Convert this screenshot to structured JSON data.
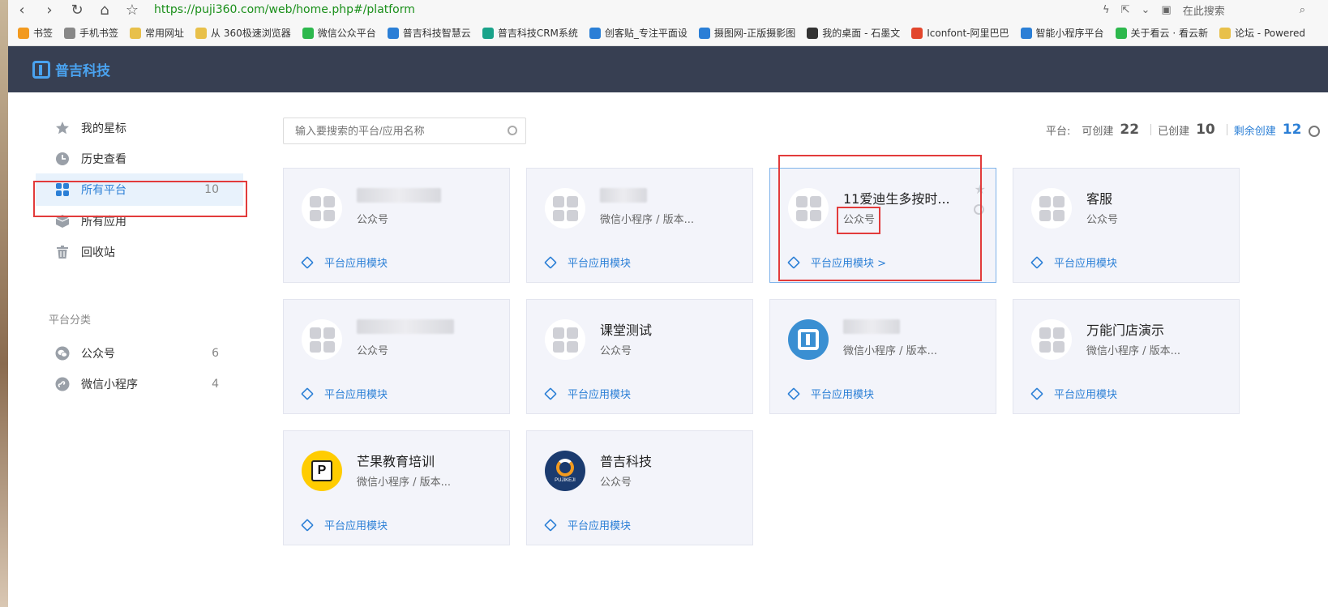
{
  "browser": {
    "url": "https://puji360.com/web/home.php#/platform",
    "search_placeholder": "在此搜索",
    "bookmarks": [
      {
        "label": "书签",
        "color": "#f29a1f"
      },
      {
        "label": "手机书签",
        "color": "#888888"
      },
      {
        "label": "常用网址",
        "color": "#e8c04a"
      },
      {
        "label": "从 360极速浏览器",
        "color": "#e8c04a"
      },
      {
        "label": "微信公众平台",
        "color": "#2db84d"
      },
      {
        "label": "普吉科技智慧云",
        "color": "#2b7fd6"
      },
      {
        "label": "普吉科技CRM系统",
        "color": "#1aa38a"
      },
      {
        "label": "创客贴_专注平面设",
        "color": "#2b7fd6"
      },
      {
        "label": "摄图网-正版摄影图",
        "color": "#2b7fd6"
      },
      {
        "label": "我的桌面 - 石墨文",
        "color": "#333333"
      },
      {
        "label": "Iconfont-阿里巴巴",
        "color": "#e2462c"
      },
      {
        "label": "智能小程序平台",
        "color": "#2b7fd6"
      },
      {
        "label": "关于看云 · 看云新",
        "color": "#2db84d"
      },
      {
        "label": "论坛 - Powered",
        "color": "#e8c04a"
      }
    ]
  },
  "header": {
    "logo_text": "普吉科技"
  },
  "sidebar": {
    "items": [
      {
        "label": "我的星标",
        "icon": "star-icon",
        "count": ""
      },
      {
        "label": "历史查看",
        "icon": "clock-icon",
        "count": ""
      },
      {
        "label": "所有平台",
        "icon": "grid-icon",
        "count": "10"
      },
      {
        "label": "所有应用",
        "icon": "cube-icon",
        "count": ""
      },
      {
        "label": "回收站",
        "icon": "trash-icon",
        "count": ""
      }
    ],
    "section_title": "平台分类",
    "categories": [
      {
        "label": "公众号",
        "icon": "wechat-icon",
        "count": "6"
      },
      {
        "label": "微信小程序",
        "icon": "miniprogram-icon",
        "count": "4"
      }
    ]
  },
  "search": {
    "placeholder": "输入要搜索的平台/应用名称"
  },
  "stats": {
    "platform_label": "平台:",
    "can_create_label": "可创建",
    "can_create_value": "22",
    "created_label": "已创建",
    "created_value": "10",
    "remaining_label": "剩余创建",
    "remaining_value": "12"
  },
  "cards": [
    {
      "name": "",
      "type": "公众号",
      "module": "平台应用模块",
      "avatar": "grid",
      "blurred": true
    },
    {
      "name": "",
      "type": "微信小程序 / 版本...",
      "module": "平台应用模块",
      "avatar": "grid",
      "blurred": true
    },
    {
      "name": "11爱迪生多按时...",
      "type": "公众号",
      "module": "平台应用模块 >",
      "avatar": "grid",
      "blurred": false,
      "highlight": true
    },
    {
      "name": "客服",
      "type": "公众号",
      "module": "平台应用模块",
      "avatar": "grid",
      "blurred": false
    },
    {
      "name": "",
      "type": "公众号",
      "module": "平台应用模块",
      "avatar": "grid",
      "blurred": true
    },
    {
      "name": "课堂测试",
      "type": "公众号",
      "module": "平台应用模块",
      "avatar": "grid",
      "blurred": false
    },
    {
      "name": "",
      "type": "微信小程序 / 版本...",
      "module": "平台应用模块",
      "avatar": "pj",
      "blurred": true
    },
    {
      "name": "万能门店演示",
      "type": "微信小程序 / 版本...",
      "module": "平台应用模块",
      "avatar": "grid",
      "blurred": false
    },
    {
      "name": "芒果教育培训",
      "type": "微信小程序 / 版本...",
      "module": "平台应用模块",
      "avatar": "pv",
      "blurred": false
    },
    {
      "name": "普吉科技",
      "type": "公众号",
      "module": "平台应用模块",
      "avatar": "pk",
      "blurred": false
    }
  ],
  "logo_texts": {
    "pv": "P",
    "pk": "PUJIKEJI"
  }
}
